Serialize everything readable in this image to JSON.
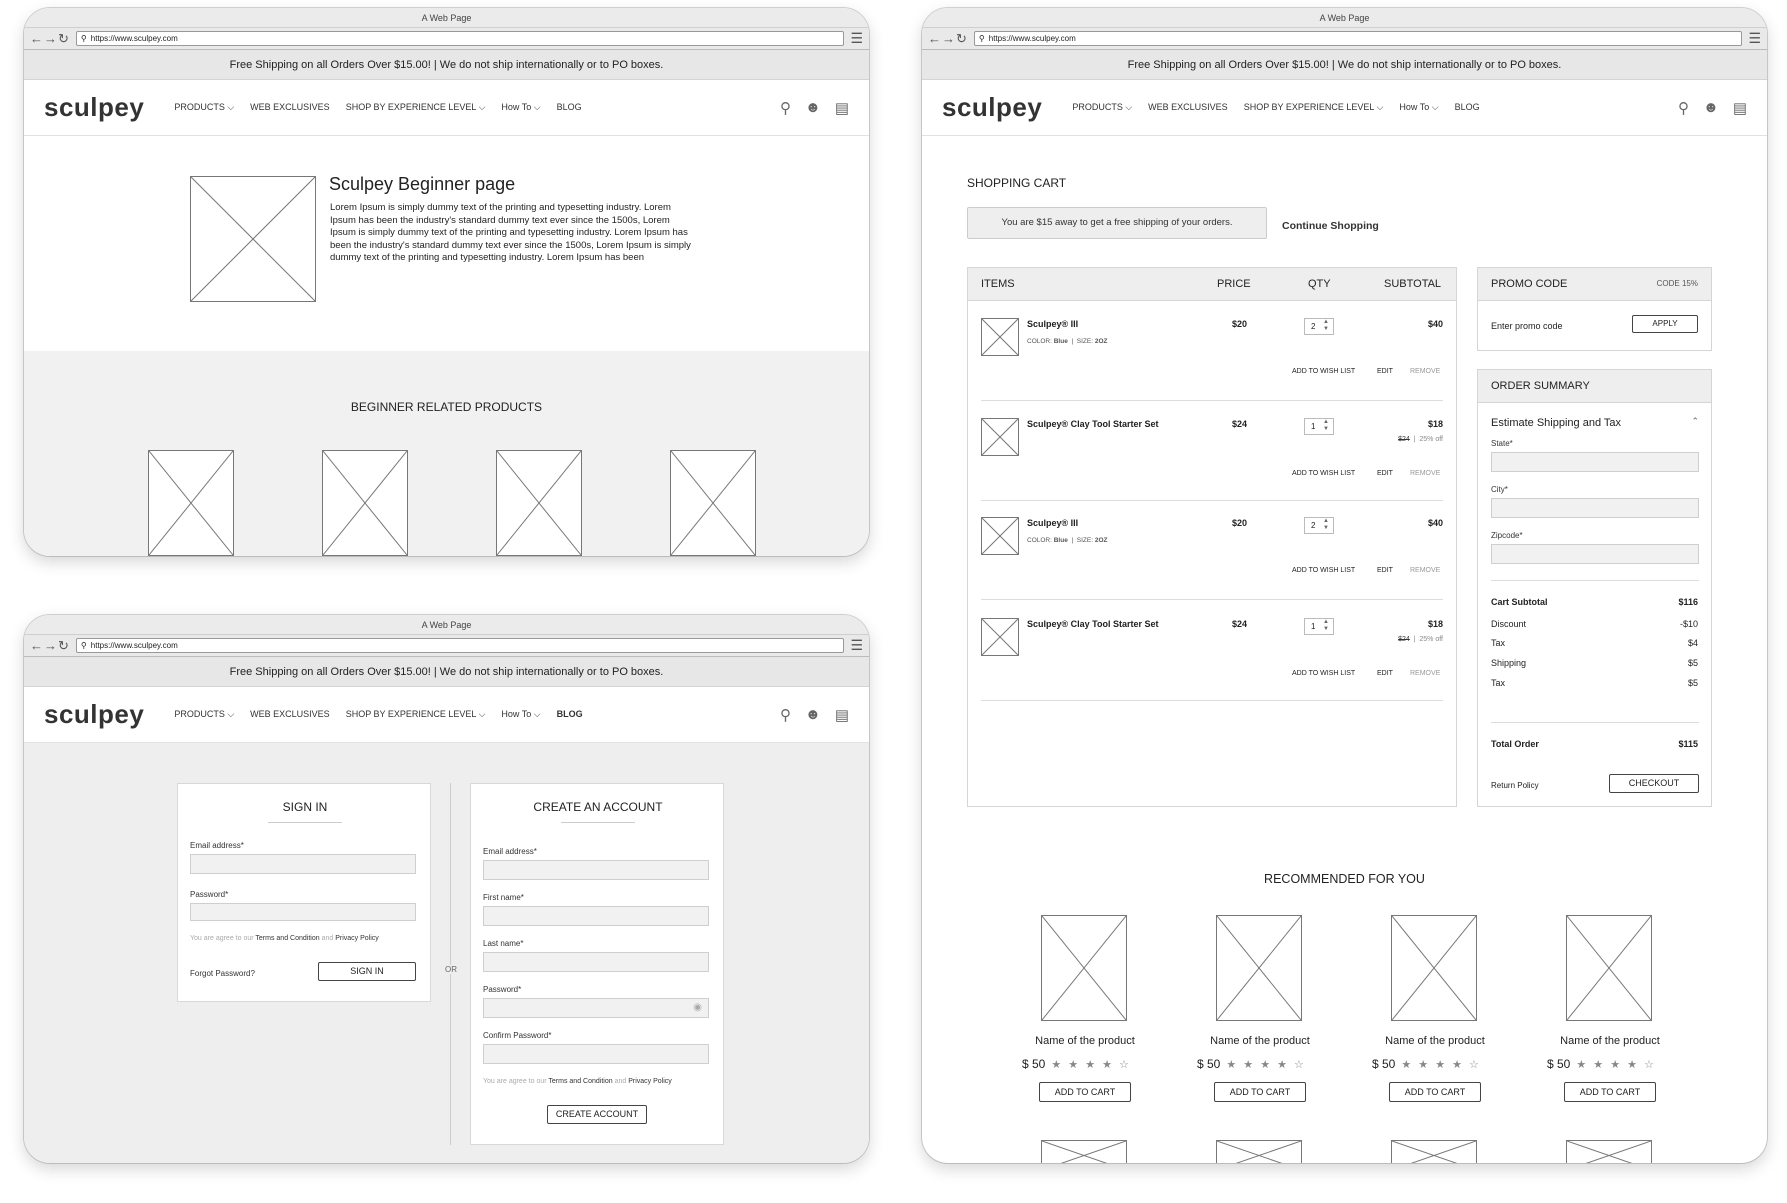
{
  "window_title": "A Web Page",
  "url": "https://www.sculpey.com",
  "promo_banner": "Free Shipping on all Orders Over $15.00!   |   We do not ship internationally or to PO boxes.",
  "logo": "sculpey",
  "nav": {
    "products": "PRODUCTS ⌵",
    "web_exclusives": "WEB EXCLUSIVES",
    "shop_by_level": "SHOP BY EXPERIENCE LEVEL ⌵",
    "how_to": "How To ⌵",
    "blog": "BLOG"
  },
  "icons": {
    "back": "arrow-left-icon",
    "forward": "arrow-right-icon",
    "reload": "reload-icon",
    "search": "search-icon",
    "user": "user-icon",
    "cart": "cart-icon",
    "menu": "hamburger-menu-icon"
  },
  "beginner": {
    "title": "Sculpey Beginner page",
    "body": "Lorem Ipsum is simply dummy text of the printing and typesetting industry. Lorem Ipsum has been the industry's standard dummy text ever since the 1500s, Lorem Ipsum is simply dummy text of the printing and typesetting industry. Lorem Ipsum has been the industry's standard dummy text ever since the 1500s, Lorem Ipsum is simply dummy text of the printing and typesetting industry. Lorem Ipsum has been",
    "related_title": "BEGINNER RELATED PRODUCTS"
  },
  "signin": {
    "title": "SIGN IN",
    "email_label": "Email address*",
    "password_label": "Password*",
    "agree_prefix": "You are agree to our",
    "terms": "Terms and Condition",
    "and": "and",
    "privacy": "Privacy Policy",
    "forgot": "Forgot Password?",
    "button": "SIGN IN",
    "or": "OR"
  },
  "create": {
    "title": "CREATE AN ACCOUNT",
    "email_label": "Email address*",
    "first_label": "First name*",
    "last_label": "Last name*",
    "password_label": "Password*",
    "confirm_label": "Confirm Password*",
    "agree_prefix": "You are agree to our",
    "terms": "Terms and Condition",
    "and": "and",
    "privacy": "Privacy Policy",
    "button": "CREATE ACCOUNT"
  },
  "cart": {
    "title": "SHOPPING CART",
    "shipping_note": "You are $15 away to get a free shipping of your orders.",
    "continue": "Continue Shopping",
    "headers": {
      "items": "ITEMS",
      "price": "PRICE",
      "qty": "QTY",
      "subtotal": "SUBTOTAL"
    },
    "items": [
      {
        "name": "Sculpey® III",
        "price": "$20",
        "qty": "2",
        "subtotal": "$40",
        "color_label": "COLOR:",
        "color": "Blue",
        "size_label": "SIZE:",
        "size": "2OZ",
        "old": "",
        "off": ""
      },
      {
        "name": "Sculpey® Clay Tool Starter Set",
        "price": "$24",
        "qty": "1",
        "subtotal": "$18",
        "color_label": "",
        "color": "",
        "size_label": "",
        "size": "",
        "old": "$24",
        "off": "25% off"
      },
      {
        "name": "Sculpey® III",
        "price": "$20",
        "qty": "2",
        "subtotal": "$40",
        "color_label": "COLOR:",
        "color": "Blue",
        "size_label": "SIZE:",
        "size": "2OZ",
        "old": "",
        "off": ""
      },
      {
        "name": "Sculpey® Clay Tool Starter Set",
        "price": "$24",
        "qty": "1",
        "subtotal": "$18",
        "color_label": "",
        "color": "",
        "size_label": "",
        "size": "",
        "old": "$24",
        "off": "25% off"
      }
    ],
    "actions": {
      "wish": "ADD TO WISH LIST",
      "edit": "EDIT",
      "remove": "REMOVE"
    }
  },
  "promo_code": {
    "title": "PROMO CODE",
    "code": "CODE 15%",
    "placeholder": "Enter promo code",
    "apply": "APPLY"
  },
  "summary": {
    "title": "ORDER SUMMARY",
    "estimate": "Estimate Shipping and Tax",
    "state": "State*",
    "city": "City*",
    "zip": "Zipcode*",
    "rows": [
      {
        "label": "Cart Subtotal",
        "value": "$116"
      },
      {
        "label": "Discount",
        "value": "-$10"
      },
      {
        "label": "Tax",
        "value": "$4"
      },
      {
        "label": "Shipping",
        "value": "$5"
      },
      {
        "label": "Tax",
        "value": "$5"
      }
    ],
    "total_label": "Total Order",
    "total": "$115",
    "return_policy": "Return Policy",
    "checkout": "CHECKOUT"
  },
  "recommended": {
    "title": "RECOMMENDED FOR YOU",
    "product_name": "Name of the product",
    "price": "$ 50",
    "rating": "★ ★ ★ ★ ☆",
    "add_to_cart": "ADD TO CART"
  }
}
